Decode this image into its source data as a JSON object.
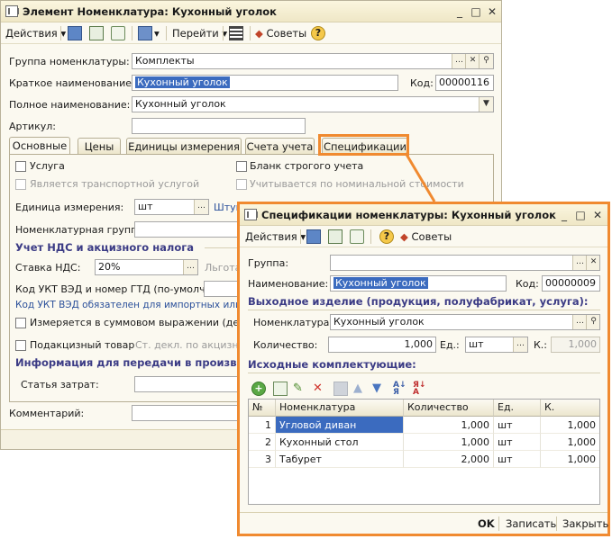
{
  "main": {
    "title": "Элемент Номенклатура: Кухонный уголок",
    "toolbar": {
      "actions": "Действия",
      "goto": "Перейти",
      "tips": "Советы"
    },
    "fields": {
      "group_label": "Группа номенклатуры:",
      "group_value": "Комплекты",
      "short_label": "Краткое наименование:",
      "short_value": "Кухонный уголок",
      "code_label": "Код:",
      "code_value": "00000116",
      "full_label": "Полное наименование:",
      "full_value": "Кухонный уголок",
      "article_label": "Артикул:"
    },
    "tabs": [
      "Основные",
      "Цены",
      "Единицы измерения",
      "Счета учета",
      "Спецификации"
    ],
    "basic": {
      "service": "Услуга",
      "transport": "Является транспортной услугой",
      "strict_form": "Бланк строгого учета",
      "nominal": "Учитывается по номинальной стоимости",
      "unit_label": "Единица измерения:",
      "unit_value": "шт",
      "unit_link": "Штук",
      "nom_group_label": "Номенклатурная группа:",
      "vat_section": "Учет НДС и акцизного налога",
      "vat_label": "Ставка НДС:",
      "vat_value": "20%",
      "vat_link": "Льгота",
      "ukt_label": "Код УКТ ВЭД и номер ГТД (по-умолч.):",
      "ukt_note": "Код УКТ ВЭД обязателен для импортных или по",
      "sum_measure": "Измеряется в суммовом выражении (действ",
      "excise": "Подакцизный товар",
      "excise_note": "Ст. декл. по акцизном",
      "prod_section": "Информация для передачи в производст",
      "cost_label": "Статья затрат:"
    },
    "comment_label": "Комментарий:"
  },
  "spec": {
    "title": "Спецификации номенклатуры: Кухонный уголок",
    "toolbar": {
      "actions": "Действия",
      "tips": "Советы"
    },
    "fields": {
      "group_label": "Группа:",
      "name_label": "Наименование:",
      "name_value": "Кухонный уголок",
      "code_label": "Код:",
      "code_value": "00000009",
      "output_section": "Выходное изделие (продукция, полуфабрикат, услуга):",
      "nom_label": "Номенклатура:",
      "nom_value": "Кухонный уголок",
      "qty_label": "Количество:",
      "qty_value": "1,000",
      "unit_label": "Ед.:",
      "unit_value": "шт",
      "k_label": "К.:",
      "k_value": "1,000",
      "input_section": "Исходные комплектующие:"
    },
    "table": {
      "headers": [
        "№",
        "Номенклатура",
        "Количество",
        "Ед.",
        "К."
      ],
      "rows": [
        [
          "1",
          "Угловой диван",
          "1,000",
          "шт",
          "1,000"
        ],
        [
          "2",
          "Кухонный стол",
          "1,000",
          "шт",
          "1,000"
        ],
        [
          "3",
          "Табурет",
          "2,000",
          "шт",
          "1,000"
        ]
      ]
    },
    "buttons": {
      "ok": "OK",
      "save": "Записать",
      "close": "Закрыть"
    }
  },
  "colors": {
    "highlight": "#f08a30",
    "selection": "#3b6bbf",
    "section": "#3b3b85"
  }
}
